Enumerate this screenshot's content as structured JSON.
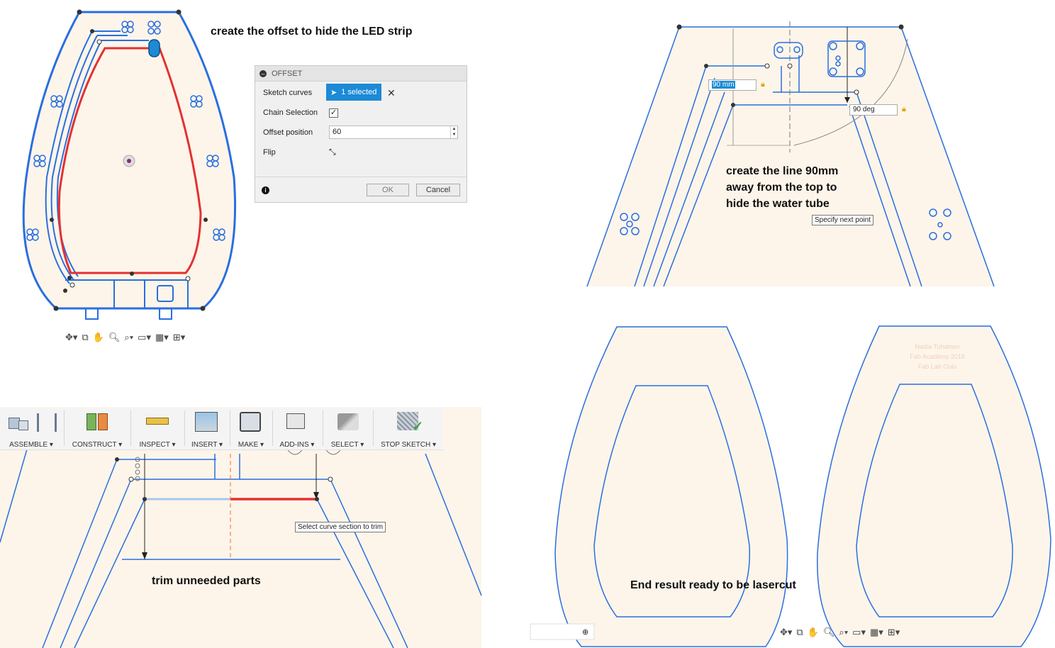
{
  "captions": {
    "offset": "create the offset to hide the LED strip",
    "line": "create the line 90mm away from the top to hide the water tube",
    "trim": "trim unneeded parts",
    "result": "End result ready to be lasercut"
  },
  "dialog": {
    "title": "OFFSET",
    "sketch_curves_label": "Sketch curves",
    "selected_label": "1 selected",
    "chain_label": "Chain Selection",
    "chain_checked": "✓",
    "offset_label": "Offset position",
    "offset_value": "60",
    "flip_label": "Flip",
    "ok_label": "OK",
    "cancel_label": "Cancel"
  },
  "sketch": {
    "dim_length": "90 mm",
    "dim_angle": "90 deg",
    "tooltip_next": "Specify next point",
    "tooltip_trim": "Select curve section to trim"
  },
  "toolbar": {
    "groups": [
      {
        "label": "ASSEMBLE ▾",
        "icon": "assemble-icon"
      },
      {
        "label": "CONSTRUCT ▾",
        "icon": "construct-icon"
      },
      {
        "label": "INSPECT ▾",
        "icon": "inspect-icon"
      },
      {
        "label": "INSERT ▾",
        "icon": "insert-icon"
      },
      {
        "label": "MAKE ▾",
        "icon": "make-icon"
      },
      {
        "label": "ADD-INS ▾",
        "icon": "add-ins-icon"
      },
      {
        "label": "SELECT ▾",
        "icon": "select-icon"
      },
      {
        "label": "STOP SKETCH ▾",
        "icon": "stop-sketch-icon"
      }
    ]
  },
  "colors": {
    "fill": "#fdf5ea",
    "outline": "#2a6ee0",
    "selected": "#e53030",
    "accent": "#1c8ad6"
  }
}
